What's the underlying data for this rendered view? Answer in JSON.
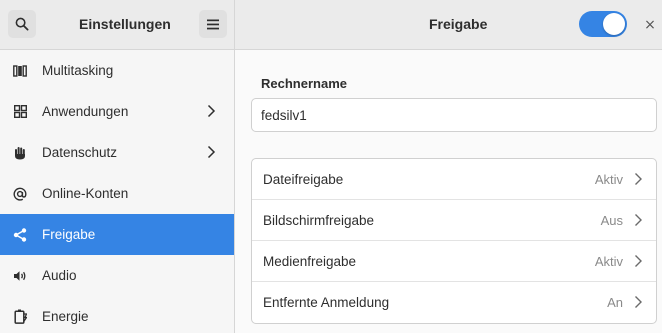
{
  "header": {
    "left_title": "Einstellungen",
    "right_title": "Freigabe",
    "search_icon": "search-icon",
    "menu_icon": "hamburger-menu-icon",
    "close_label": "×",
    "sharing_toggle_on": true,
    "accent_color": "#3584e4"
  },
  "sidebar": {
    "items": [
      {
        "label": "Multitasking",
        "icon": "multitasking-icon",
        "has_chevron": false,
        "active": false
      },
      {
        "label": "Anwendungen",
        "icon": "apps-grid-icon",
        "has_chevron": true,
        "active": false
      },
      {
        "label": "Datenschutz",
        "icon": "hand-icon",
        "has_chevron": true,
        "active": false
      },
      {
        "label": "Online-Konten",
        "icon": "at-sign-icon",
        "has_chevron": false,
        "active": false
      },
      {
        "label": "Freigabe",
        "icon": "share-icon",
        "has_chevron": false,
        "active": true
      },
      {
        "label": "Audio",
        "icon": "speaker-icon",
        "has_chevron": false,
        "active": false
      },
      {
        "label": "Energie",
        "icon": "battery-icon",
        "has_chevron": false,
        "active": false
      }
    ]
  },
  "main": {
    "computer_name_label": "Rechnername",
    "computer_name_value": "fedsilv1",
    "rows": [
      {
        "label": "Dateifreigabe",
        "status": "Aktiv"
      },
      {
        "label": "Bildschirmfreigabe",
        "status": "Aus"
      },
      {
        "label": "Medienfreigabe",
        "status": "Aktiv"
      },
      {
        "label": "Entfernte Anmeldung",
        "status": "An"
      }
    ]
  }
}
